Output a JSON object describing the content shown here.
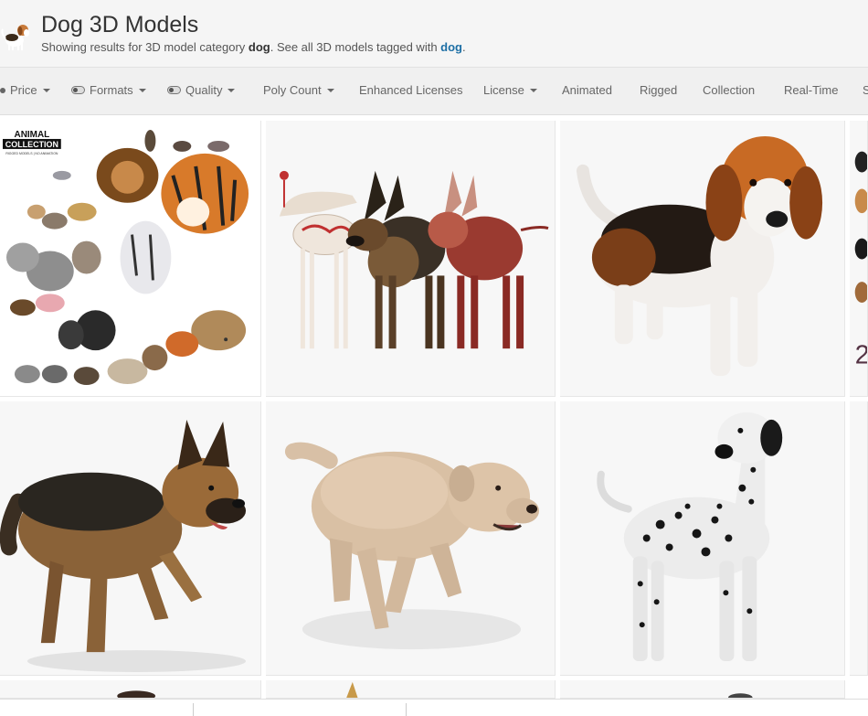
{
  "header": {
    "title": "Dog 3D Models",
    "subtitle_prefix": "Showing results for 3D model category ",
    "subtitle_category": "dog",
    "subtitle_mid": ". See all 3D models tagged with ",
    "subtitle_tag_link": "dog",
    "subtitle_suffix": ".",
    "logo_icon": "beagle-logo-icon"
  },
  "filters": [
    {
      "label": "Price",
      "has_caret": true,
      "has_toggle": false
    },
    {
      "label": "Formats",
      "has_caret": true,
      "has_toggle": true
    },
    {
      "label": "Quality",
      "has_caret": true,
      "has_toggle": true
    },
    {
      "label": "Poly Count",
      "has_caret": true,
      "has_toggle": false
    },
    {
      "label": "Enhanced Licenses",
      "has_caret": false,
      "has_toggle": false
    },
    {
      "label": "License",
      "has_caret": true,
      "has_toggle": false
    },
    {
      "label": "Animated",
      "has_caret": false,
      "has_toggle": false
    },
    {
      "label": "Rigged",
      "has_caret": false,
      "has_toggle": false
    },
    {
      "label": "Collection",
      "has_caret": false,
      "has_toggle": false
    },
    {
      "label": "Real-Time",
      "has_caret": false,
      "has_toggle": false
    },
    {
      "label": "S",
      "has_caret": false,
      "has_toggle": false
    }
  ],
  "grid": {
    "tiles": [
      {
        "name": "animal-collection-thumbnail",
        "badge_title": "ANIMAL",
        "badge_subtitle": "COLLECTION",
        "badge_small": "RIGGED MODELS | NO ANIMATION"
      },
      {
        "name": "dog-anatomy-thumbnail"
      },
      {
        "name": "beagle-thumbnail"
      },
      {
        "name": "partial-thumbnail-right",
        "partial_char": "2"
      },
      {
        "name": "german-shepherd-running-thumbnail"
      },
      {
        "name": "labrador-running-thumbnail"
      },
      {
        "name": "dalmatian-thumbnail"
      }
    ]
  },
  "colors": {
    "link": "#1d6fa5",
    "header_bg": "#f5f5f5",
    "filterbar_bg": "#f0f0f0"
  }
}
